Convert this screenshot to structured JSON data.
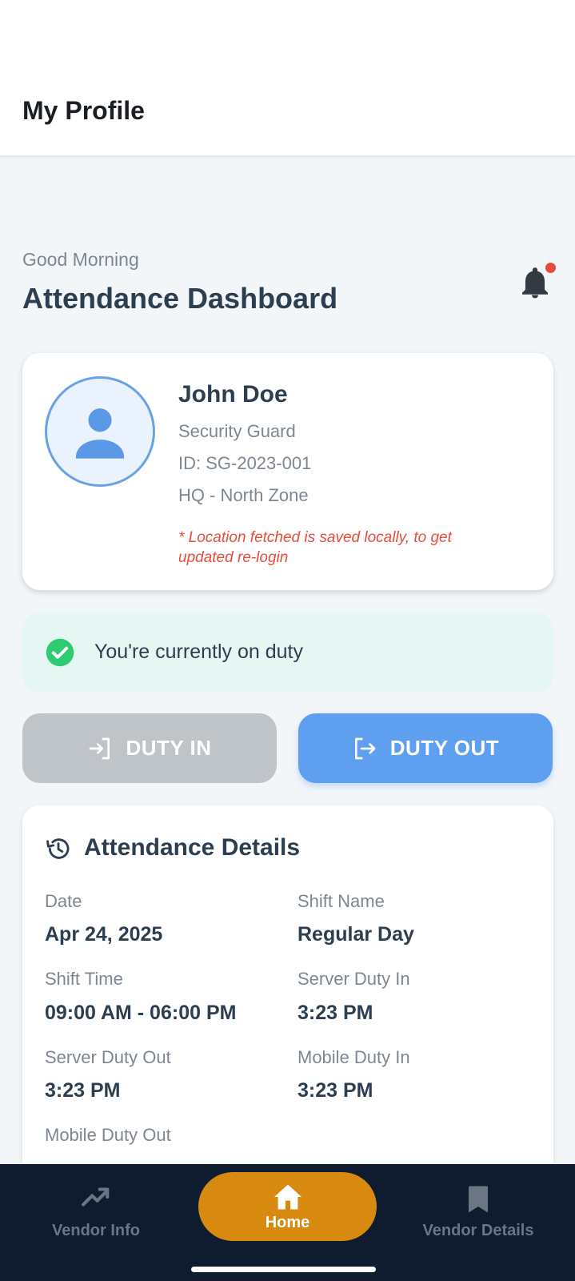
{
  "header": {
    "title": "My Profile"
  },
  "dashboard": {
    "greeting": "Good Morning",
    "title": "Attendance Dashboard",
    "notification_icon": "bell-icon",
    "has_unread": true
  },
  "profile": {
    "name": "John Doe",
    "role": "Security Guard",
    "id": "ID: SG-2023-001",
    "location": "HQ - North Zone",
    "note_line1": "* Location fetched is saved locally, to get",
    "note_line2": "updated re-login",
    "avatar_icon": "person-icon"
  },
  "duty_status": {
    "text": "You're currently on duty",
    "icon": "check-circle-icon",
    "color": "#2ecc71"
  },
  "actions": {
    "duty_in_label": "DUTY IN",
    "duty_out_label": "DUTY OUT",
    "duty_in_enabled": false,
    "duty_out_enabled": true,
    "duty_out_color": "#5f9ff0"
  },
  "attendance_details": {
    "title": "Attendance Details",
    "icon": "history-icon",
    "fields": [
      {
        "label": "Date",
        "value": "Apr 24, 2025"
      },
      {
        "label": "Shift Name",
        "value": "Regular Day"
      },
      {
        "label": "Shift Time",
        "value": "09:00 AM - 06:00 PM"
      },
      {
        "label": "Server Duty In",
        "value": "3:23 PM"
      },
      {
        "label": "Server Duty Out",
        "value": "3:23 PM"
      },
      {
        "label": "Mobile Duty In",
        "value": "3:23 PM"
      },
      {
        "label": "Mobile Duty Out",
        "value": ""
      }
    ]
  },
  "bottom_nav": {
    "items": [
      {
        "label": "Vendor Info",
        "icon": "trending-up-icon",
        "active": false
      },
      {
        "label": "Home",
        "icon": "home-icon",
        "active": true
      },
      {
        "label": "Vendor Details",
        "icon": "bookmark-icon",
        "active": false
      }
    ],
    "active_color": "#d78a0f"
  }
}
